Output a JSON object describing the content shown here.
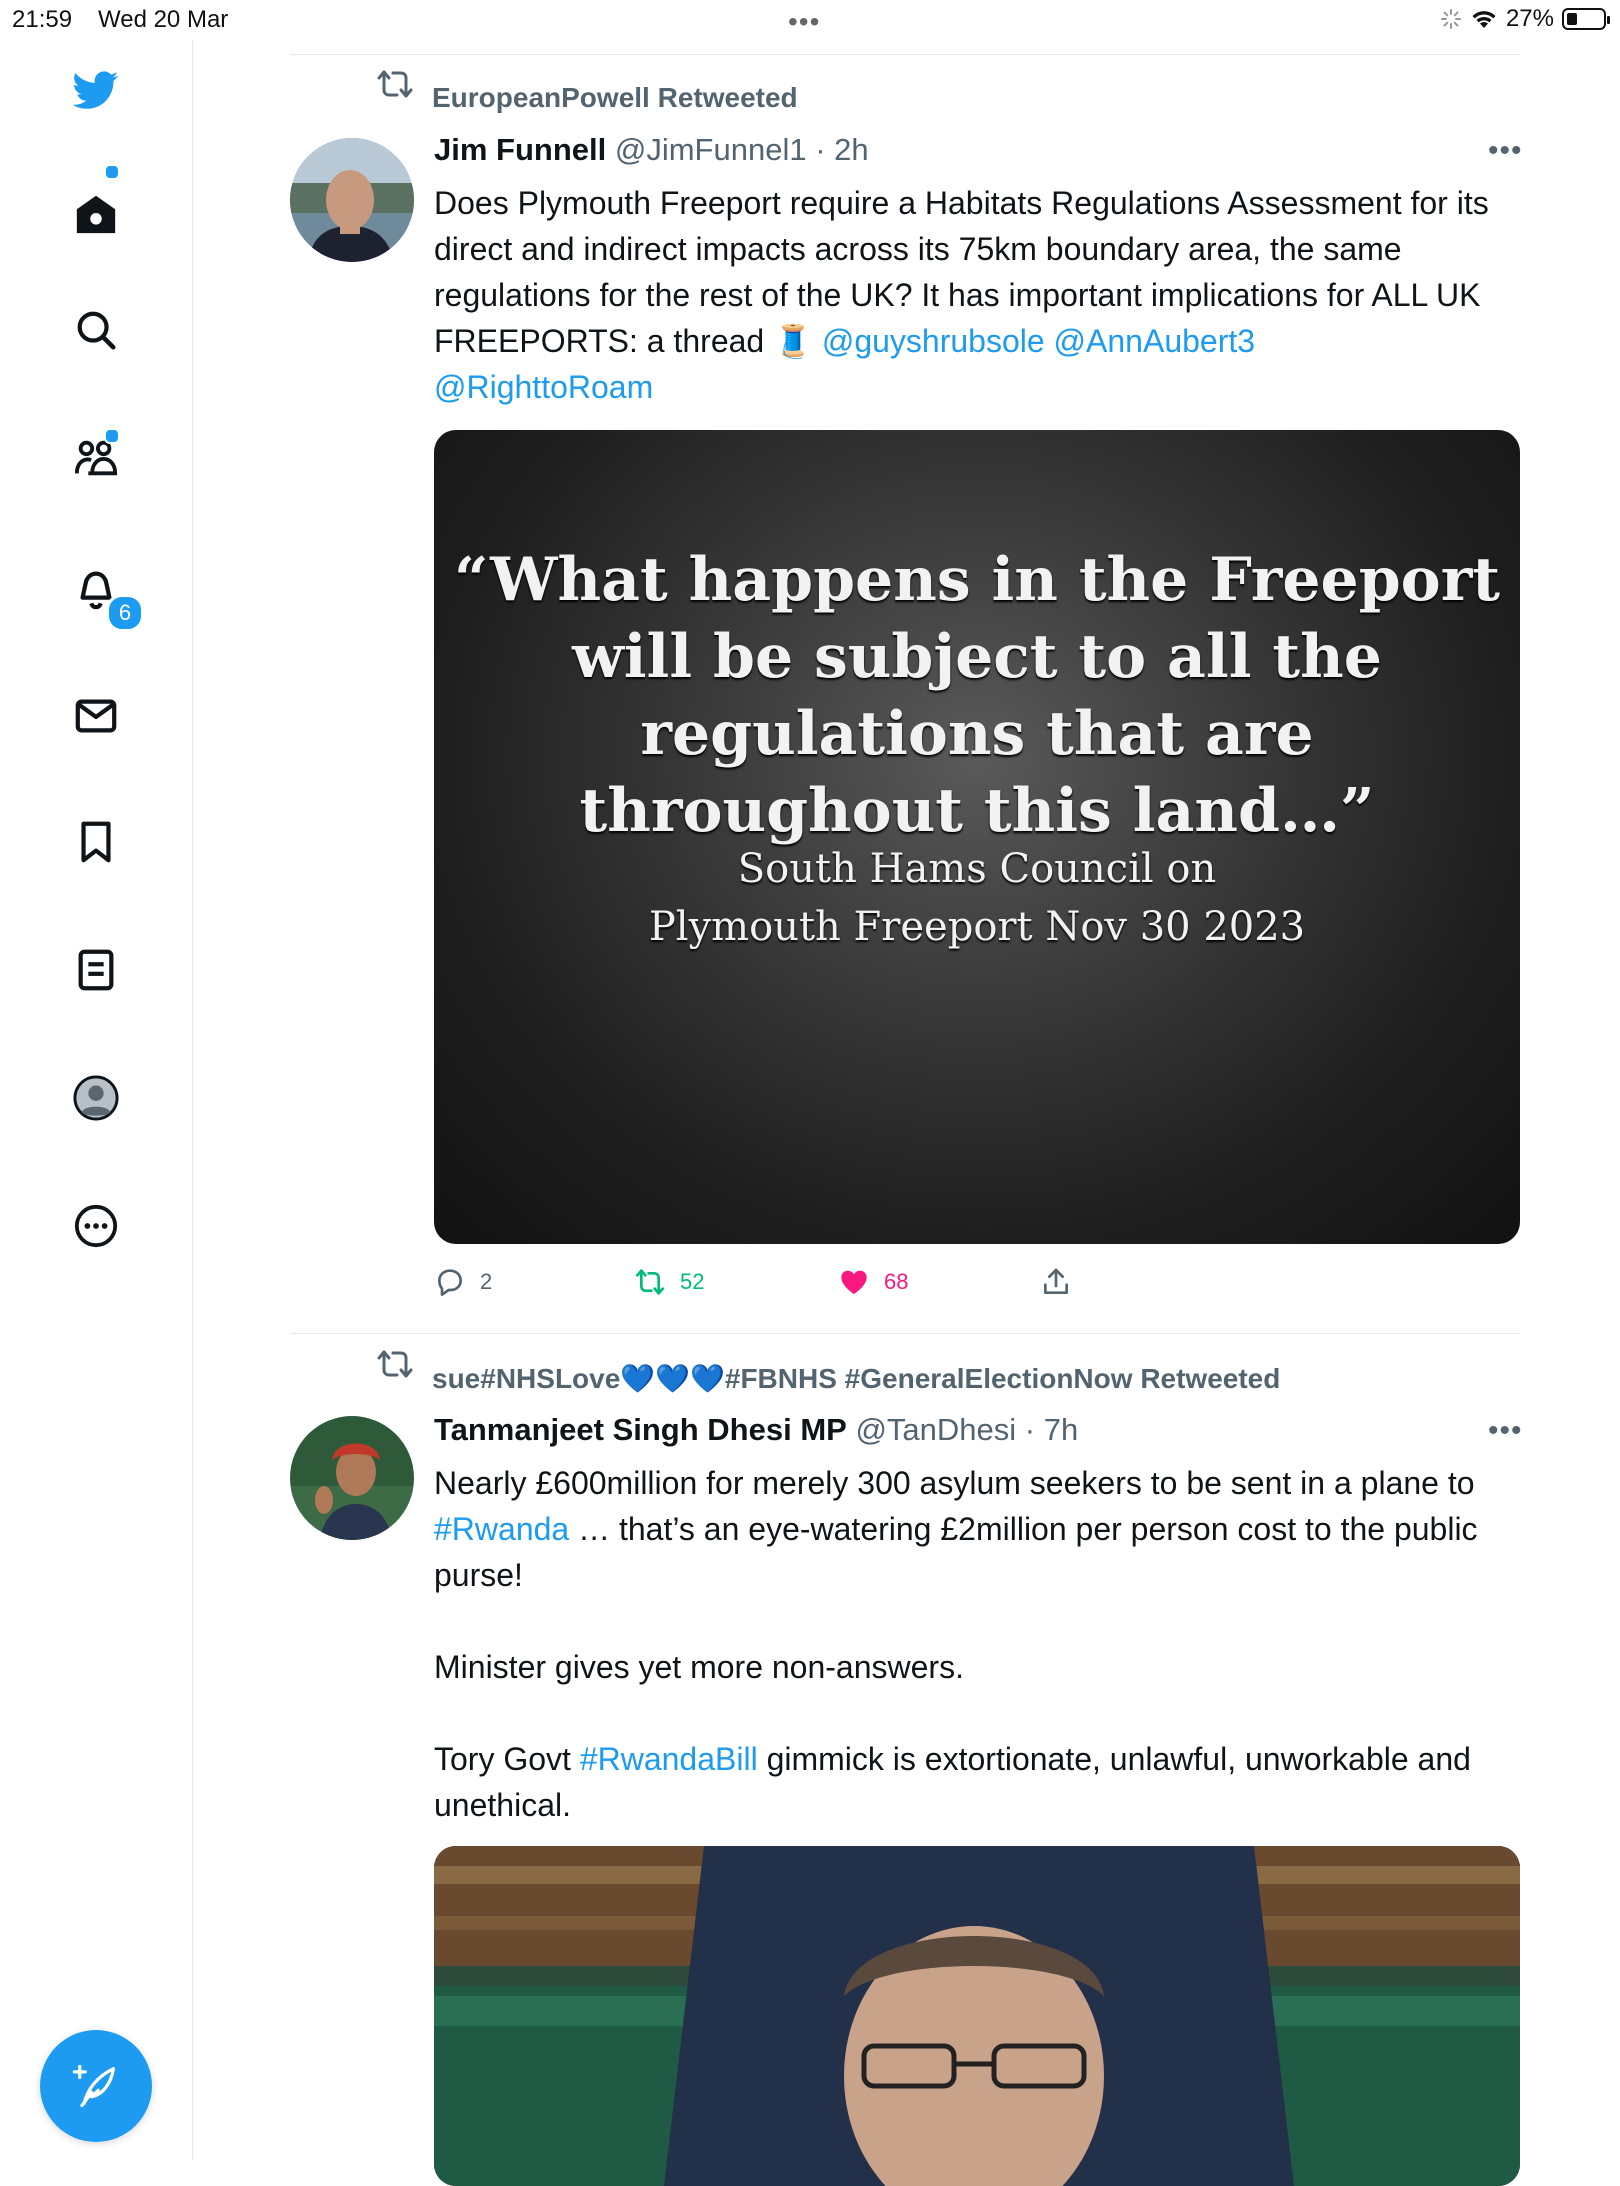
{
  "status_bar": {
    "time": "21:59",
    "date": "Wed 20 Mar",
    "battery": "27%",
    "battery_level": 0.27
  },
  "sidebar": {
    "items": [
      {
        "name": "home"
      },
      {
        "name": "explore"
      },
      {
        "name": "communities"
      },
      {
        "name": "notifications",
        "badge": "6"
      },
      {
        "name": "messages"
      },
      {
        "name": "bookmarks"
      },
      {
        "name": "lists"
      },
      {
        "name": "profile"
      },
      {
        "name": "more"
      }
    ]
  },
  "tweets": [
    {
      "retweeted_by": "EuropeanPowell Retweeted",
      "author_name": "Jim Funnell",
      "author_handle": "@JimFunnel1",
      "time": "2h",
      "text_plain": "Does Plymouth Freeport require a Habitats Regulations Assessment for its direct and indirect impacts across its 75km boundary area, the same regulations for the rest of the UK? It has important implications for ALL UK FREEPORTS: a thread 🧵 ",
      "mentions_line1": "@guyshrubsole @AnnAubert3",
      "mentions_line2": "@RighttoRoam",
      "media_quote": "“What happens in the Freeport will be subject to all the regulations that are throughout this land…”",
      "media_source_line1": "South Hams Council on",
      "media_source_line2": "Plymouth Freeport Nov 30 2023",
      "replies": "2",
      "retweets": "52",
      "likes": "68"
    },
    {
      "retweeted_by": "sue#NHSLove💙💙💙#FBNHS #GeneralElectionNow Retweeted",
      "author_name": "Tanmanjeet Singh Dhesi MP",
      "author_handle": "@TanDhesi",
      "time": "7h",
      "p1_a": "Nearly £600million for merely 300 asylum seekers to be sent in a plane to ",
      "p1_link": "#Rwanda",
      "p1_b": " … that’s an eye-watering £2million per person cost to the public purse!",
      "p2": "Minister gives yet more non-answers.",
      "p3_a": "Tory Govt ",
      "p3_link": "#RwandaBill",
      "p3_b": " gimmick is extortionate, unlawful, unworkable and unethical."
    }
  ],
  "colors": {
    "accent": "#1d9bf0",
    "retweet_green": "#00ba7c",
    "like_pink": "#f91880",
    "secondary_text": "#536471"
  }
}
